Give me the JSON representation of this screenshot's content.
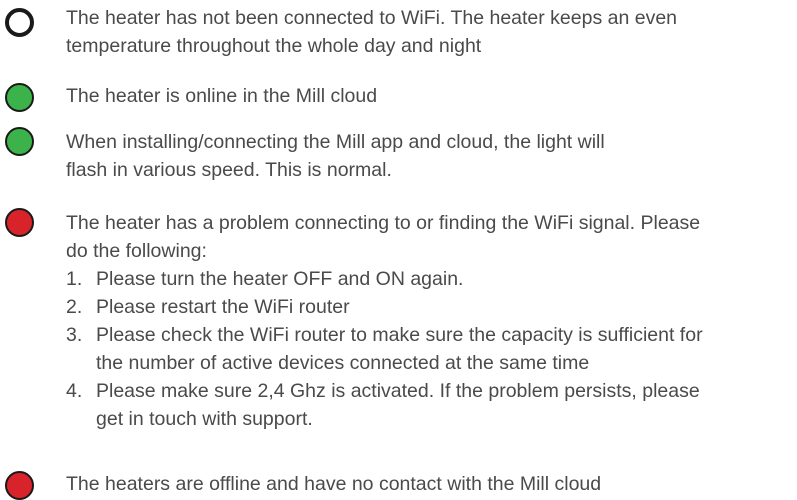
{
  "items": [
    {
      "status_color": "#ffffff",
      "lines": [
        "The heater has not been connected to WiFi. The heater keeps an even",
        "temperature throughout the whole day and night"
      ]
    },
    {
      "status_color": "#3bb34a",
      "lines": [
        "The heater is online in the Mill cloud"
      ]
    },
    {
      "status_color": "#3bb34a",
      "lines": [
        "When installing/connecting the Mill app and cloud, the light will",
        "flash in various speed. This is normal."
      ]
    },
    {
      "status_color": "#d8232a",
      "lines": [
        "The heater has a problem connecting to or finding the WiFi signal. Please",
        "do the following:"
      ],
      "steps": [
        {
          "number": "1.",
          "lines": [
            "Please turn the heater OFF and ON again."
          ]
        },
        {
          "number": "2.",
          "lines": [
            "Please restart the WiFi router"
          ]
        },
        {
          "number": "3.",
          "lines": [
            "Please check the WiFi router to make sure the capacity is sufficient for",
            "the number of active devices connected at the same time"
          ]
        },
        {
          "number": "4.",
          "lines": [
            "Please make sure 2,4 Ghz is activated. If the problem persists, please",
            "get in touch with support."
          ]
        }
      ]
    },
    {
      "status_color": "#d8232a",
      "lines": [
        "The heaters are offline and have no contact with the Mill cloud"
      ]
    }
  ]
}
